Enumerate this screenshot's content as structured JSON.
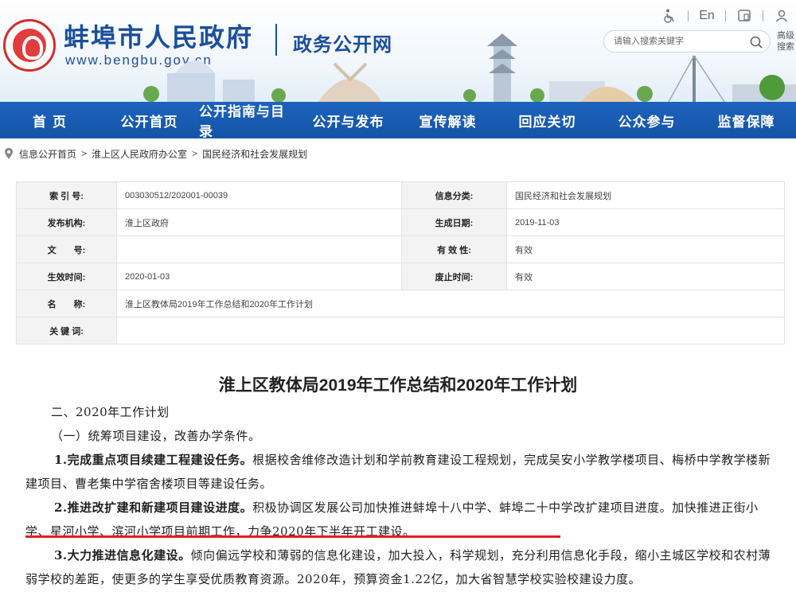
{
  "header": {
    "site_name": "蚌埠市人民政府",
    "site_url": "www.bengbu.gov.cn",
    "portal_name": "政务公开网",
    "toolbar": {
      "accessibility_icon": "wheelchair-icon",
      "language_label": "En",
      "app_icon": "mobile-app-icon",
      "user_icon": "user-icon",
      "search_icon": "search-icon"
    },
    "search": {
      "placeholder": "请输入搜索关键字"
    },
    "advanced_search_label": "高级搜索"
  },
  "nav": {
    "items": [
      "首 页",
      "公开首页",
      "公开指南与目录",
      "公开与发布",
      "宣传解读",
      "回应关切",
      "公众参与",
      "监督保障"
    ]
  },
  "breadcrumb": {
    "items": [
      "信息公开首页",
      "淮上区人民政府办公室",
      "国民经济和社会发展规划"
    ],
    "separator": ">"
  },
  "meta": {
    "index_label": "索 引 号:",
    "index_value": "003030512/202001-00039",
    "category_label": "信息分类:",
    "category_value": "国民经济和社会发展规划",
    "publisher_label": "发布机构:",
    "publisher_value": "淮上区政府",
    "created_label": "生成日期:",
    "created_value": "2019-11-03",
    "docno_label": "文　　号:",
    "docno_value": "",
    "validity_label": "有 效 性:",
    "validity_value": "有效",
    "effective_label": "生效时间:",
    "effective_value": "2020-01-03",
    "repeal_label": "废止时间:",
    "repeal_value": "有效",
    "name_label": "名　　称:",
    "name_value": "淮上区教体局2019年工作总结和2020年工作计划",
    "keywords_label": "关 键 词:",
    "keywords_value": ""
  },
  "article": {
    "title": "淮上区教体局2019年工作总结和2020年工作计划",
    "section": "二、2020年工作计划",
    "subsection": "（一）统筹项目建设，改善办学条件。",
    "p1_lead": "1.完成重点项目续建工程建设任务。",
    "p1_body": "根据校舍维修改造计划和学前教育建设工程规划，完成吴安小学教学楼项目、梅桥中学教学楼新建项目、曹老集中学宿舍楼项目等建设任务。",
    "p2_lead": "2.推进改扩建和新建项目建设进度。",
    "p2_body": "积极协调区发展公司加快推进蚌埠十八中学、蚌埠二十中学改扩建项目进度。加快推进正街小学、星河小学、滨河小学项目前期工作，力争2020年下半年开工建设。",
    "p3_lead": "3.大力推进信息化建设。",
    "p3_body": "倾向偏远学校和薄弱的信息化建设，加大投入，科学规划，充分利用信息化手段，缩小主城区学校和农村薄弱学校的差距，使更多的学生享受优质教育资源。2020年，预算资金1.22亿，加大省智慧学校实验校建设力度。"
  },
  "colors": {
    "brand_blue": "#1a4f9c",
    "nav_blue": "#1d63bd",
    "highlight_red": "#e02020"
  }
}
